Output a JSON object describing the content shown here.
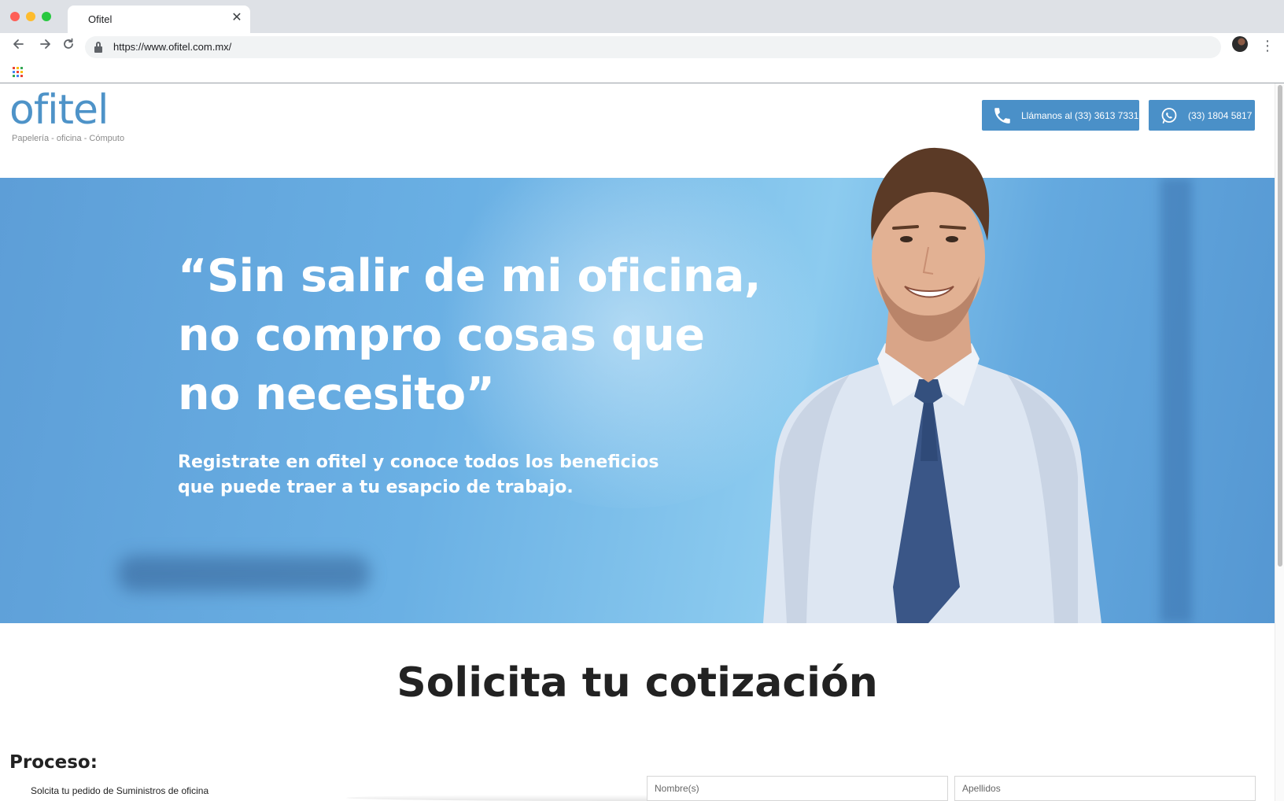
{
  "browser": {
    "tab_title": "Ofitel",
    "tab_close": "✕",
    "url": "https://www.ofitel.com.mx/",
    "apps_colors": [
      "#ea4335",
      "#fbbc05",
      "#34a853",
      "#4285f4",
      "#ea4335",
      "#fbbc05",
      "#34a853",
      "#4285f4",
      "#ea4335"
    ]
  },
  "header": {
    "logo_word": "ofitel",
    "logo_tagline": "Papelería - oficina - Cómputo",
    "call_label": "Llámanos al (33) 3613 7331",
    "whatsapp_label": "(33) 1804 5817",
    "accent_color": "#4a90c8"
  },
  "hero": {
    "quote_lines": [
      "“Sin salir de mi oficina,",
      "no compro cosas que",
      "no necesito”"
    ],
    "sub_lines": [
      "Registrate en ofitel y conoce todos los beneficios",
      "que puede traer a tu esapcio de trabajo."
    ]
  },
  "quote_section": {
    "title": "Solicita tu cotización",
    "process_heading": "Proceso:",
    "steps": [
      "Solcita tu pedido de Suministros de oficina"
    ],
    "form": {
      "first_name_placeholder": "Nombre(s)",
      "last_name_placeholder": "Apellidos"
    }
  }
}
